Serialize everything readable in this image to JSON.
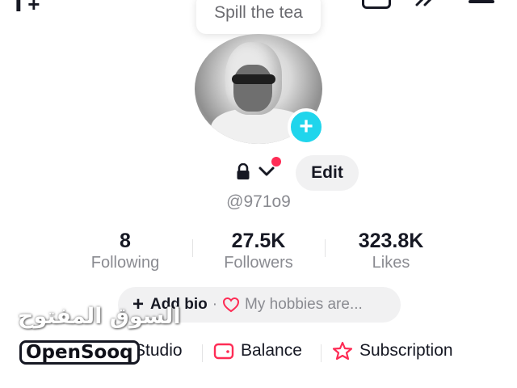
{
  "bubble": {
    "text": "Spill the tea"
  },
  "profile": {
    "username": "@971o9",
    "edit_label": "Edit"
  },
  "stats": [
    {
      "value": "8",
      "label": "Following"
    },
    {
      "value": "27.5K",
      "label": "Followers"
    },
    {
      "value": "323.8K",
      "label": "Likes"
    }
  ],
  "bio": {
    "add_label": "Add bio",
    "separator": "·",
    "hobbies_placeholder": "My hobbies are..."
  },
  "bottom": {
    "studio": "Studio",
    "balance": "Balance",
    "subscription": "Subscription"
  },
  "watermark": {
    "arabic": "السوق المفتوح",
    "latin": "OpenSooq"
  },
  "icons": {
    "top_left": "add-user-icon",
    "inbox": "inbox-icon",
    "stream": "arrow-icon",
    "menu": "menu-icon",
    "lock": "lock-icon",
    "chevron": "chevron-down-icon",
    "plus": "plus-icon",
    "heart": "heart-icon",
    "wallet": "wallet-icon",
    "star": "star-icon"
  },
  "colors": {
    "accent_cyan": "#20d5ec",
    "accent_red": "#fe2c55",
    "text_primary": "#161823",
    "text_secondary": "#8a8b91",
    "pill_bg": "#f1f1f2"
  }
}
